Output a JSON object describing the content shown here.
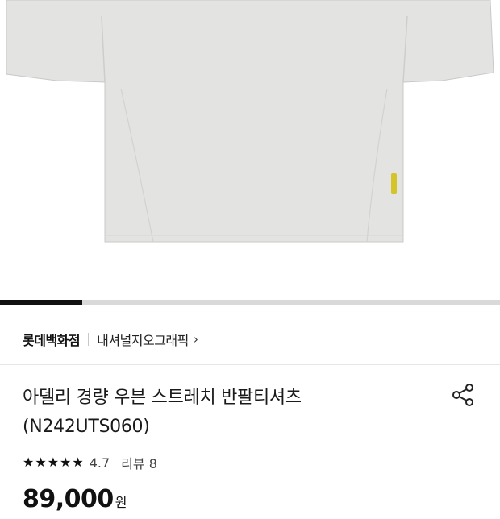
{
  "gallery": {
    "progress": 0.165
  },
  "brand": {
    "store": "롯데백화점",
    "name": "내셔널지오그래픽",
    "chevron": "›"
  },
  "product": {
    "title_line1": "아델리 경량 우븐 스트레치 반팔티셔츠",
    "title_line2": "(N242UTS060)",
    "rating": "4.7",
    "review_label": "리뷰 8",
    "stars_filled": 5,
    "price": "89,000",
    "price_unit": "원"
  },
  "icons": {
    "share": "share-icon",
    "star": "star-icon",
    "chevron": "chevron-right-icon"
  },
  "colors": {
    "shirt": "#e3e3e1",
    "shirt_shadow": "#cfcfcd",
    "progress": "#111111",
    "progress_track": "#d9d9d9",
    "tag": "#d4c42a"
  }
}
